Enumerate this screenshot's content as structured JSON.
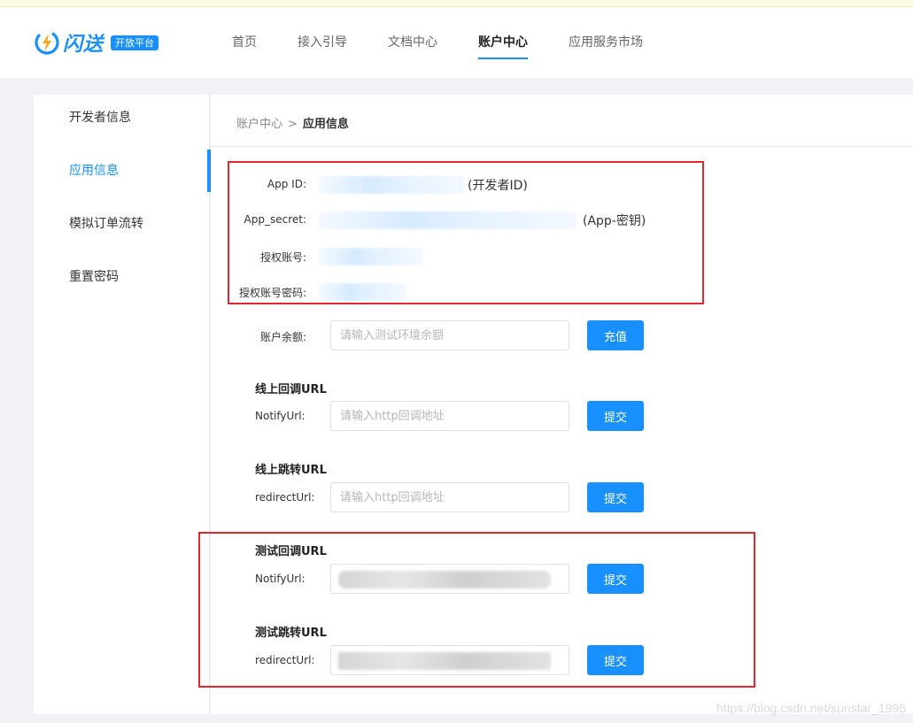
{
  "brand": {
    "name": "闪送",
    "badge": "开放平台",
    "color": "#1890ff",
    "icon": "lightning-logo-icon"
  },
  "nav": {
    "items": [
      {
        "label": "首页"
      },
      {
        "label": "接入引导"
      },
      {
        "label": "文档中心"
      },
      {
        "label": "账户中心",
        "active": true
      },
      {
        "label": "应用服务市场"
      }
    ]
  },
  "sidebar": {
    "items": [
      {
        "label": "开发者信息"
      },
      {
        "label": "应用信息",
        "active": true
      },
      {
        "label": "模拟订单流转"
      },
      {
        "label": "重置密码"
      }
    ]
  },
  "breadcrumb": {
    "parent": "账户中心",
    "separator": ">",
    "current": "应用信息"
  },
  "credentials": {
    "app_id": {
      "label": "App ID:",
      "note": "(开发者ID)"
    },
    "app_secret": {
      "label": "App_secret:",
      "note": "(App-密钥)"
    },
    "auth_account": {
      "label": "授权账号:"
    },
    "auth_password": {
      "label": "授权账号密码:"
    }
  },
  "balance": {
    "label": "账户余额:",
    "placeholder": "请输入测试环境余额",
    "button": "充值"
  },
  "online_notify": {
    "title": "线上回调URL",
    "label": "NotifyUrl:",
    "placeholder": "请输入http回调地址",
    "button": "提交"
  },
  "online_redirect": {
    "title": "线上跳转URL",
    "label": "redirectUrl:",
    "placeholder": "请输入http回调地址",
    "button": "提交"
  },
  "test_notify": {
    "title": "测试回调URL",
    "label": "NotifyUrl:",
    "button": "提交"
  },
  "test_redirect": {
    "title": "测试跳转URL",
    "label": "redirectUrl:",
    "button": "提交"
  },
  "colors": {
    "accent": "#1890ff",
    "highlight_box": "#e0292f"
  },
  "watermark": "https://blog.csdn.net/sunstar_1995"
}
